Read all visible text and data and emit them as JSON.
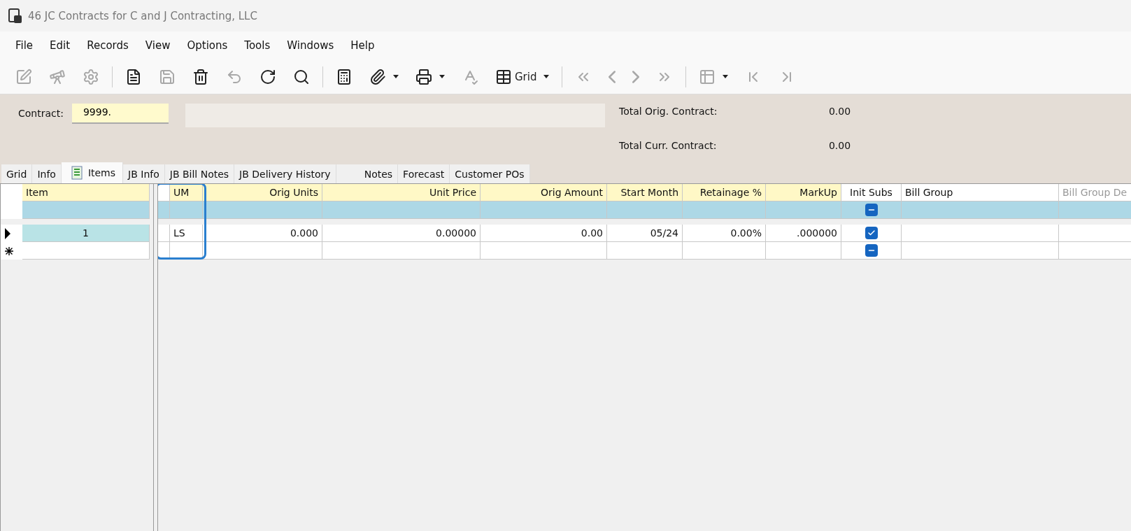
{
  "window": {
    "title": "46 JC Contracts for C and J Contracting, LLC"
  },
  "menu": [
    "File",
    "Edit",
    "Records",
    "View",
    "Options",
    "Tools",
    "Windows",
    "Help"
  ],
  "toolbar": [
    {
      "kind": "edit",
      "disabled": true
    },
    {
      "kind": "binoculars",
      "disabled": true
    },
    {
      "kind": "gear",
      "disabled": true
    },
    {
      "kind": "separator"
    },
    {
      "kind": "file",
      "disabled": false
    },
    {
      "kind": "save",
      "disabled": true
    },
    {
      "kind": "trash",
      "disabled": false
    },
    {
      "kind": "undo",
      "disabled": true
    },
    {
      "kind": "refresh",
      "disabled": false
    },
    {
      "kind": "search",
      "disabled": false
    },
    {
      "kind": "separator"
    },
    {
      "kind": "calculator",
      "disabled": false
    },
    {
      "kind": "paperclip",
      "disabled": false,
      "dropdown": true
    },
    {
      "kind": "printer",
      "disabled": false,
      "dropdown": true
    },
    {
      "kind": "spellcheck",
      "disabled": true
    },
    {
      "kind": "grid",
      "disabled": false,
      "dropdown": true,
      "label": "Grid"
    },
    {
      "kind": "separator"
    },
    {
      "kind": "first",
      "disabled": true
    },
    {
      "kind": "prev",
      "disabled": true
    },
    {
      "kind": "next",
      "disabled": true
    },
    {
      "kind": "last",
      "disabled": true
    },
    {
      "kind": "separator"
    },
    {
      "kind": "table-settings",
      "disabled": true,
      "dropdown": true
    },
    {
      "kind": "home",
      "disabled": true
    },
    {
      "kind": "end",
      "disabled": true
    }
  ],
  "header": {
    "contract_label": "Contract:",
    "contract_value": "9999.",
    "totals": [
      {
        "label": "Total Orig. Contract:",
        "value": "0.00"
      },
      {
        "label": "Total Curr. Contract:",
        "value": "0.00"
      }
    ]
  },
  "tabs": [
    {
      "label": "Grid",
      "selected": false
    },
    {
      "label": "Info",
      "selected": false
    },
    {
      "label": "Items",
      "selected": true
    },
    {
      "label": "JB Info",
      "selected": false
    },
    {
      "label": "JB Bill Notes",
      "selected": false
    },
    {
      "label": "JB Delivery History",
      "selected": false
    },
    {
      "label": "Notes",
      "selected": false,
      "wide": true
    },
    {
      "label": "Forecast",
      "selected": false
    },
    {
      "label": "Customer POs",
      "selected": false
    }
  ],
  "left_grid": {
    "column": "Item",
    "rows": [
      {
        "current": true,
        "new": false,
        "item": "1"
      },
      {
        "current": false,
        "new": true,
        "item": ""
      }
    ]
  },
  "right_grid": {
    "columns": [
      {
        "label": "UM",
        "kind": "text",
        "required": true,
        "outlined": true
      },
      {
        "label": "Orig Units",
        "kind": "number",
        "required": true,
        "outlined": false
      },
      {
        "label": "Unit Price",
        "kind": "number",
        "required": true,
        "outlined": false
      },
      {
        "label": "Orig Amount",
        "kind": "number",
        "required": true,
        "outlined": false
      },
      {
        "label": "Start Month",
        "kind": "number",
        "required": true,
        "outlined": false
      },
      {
        "label": "Retainage %",
        "kind": "number",
        "required": true,
        "outlined": false
      },
      {
        "label": "MarkUp",
        "kind": "number",
        "required": true,
        "outlined": false
      },
      {
        "label": "Init Subs",
        "kind": "checkbox",
        "required": false,
        "outlined": false
      },
      {
        "label": "Bill Group",
        "kind": "text",
        "required": false,
        "outlined": false
      },
      {
        "label": "Bill Group De",
        "kind": "text",
        "required": false,
        "outlined": false,
        "dimmed": true
      }
    ],
    "filter_init_subs_checked": false,
    "filter_init_subs_indeterminate": true,
    "rows": [
      {
        "cells": [
          "LS",
          "0.000",
          "0.00000",
          "0.00",
          "05/24",
          "0.00%",
          ".000000",
          "",
          "",
          ""
        ],
        "init_subs_checked": true
      },
      {
        "cells": [
          "",
          "",
          "",
          "",
          "",
          "",
          "",
          "",
          "",
          ""
        ],
        "init_subs_checked": false,
        "init_subs_indeterminate": true
      }
    ]
  }
}
